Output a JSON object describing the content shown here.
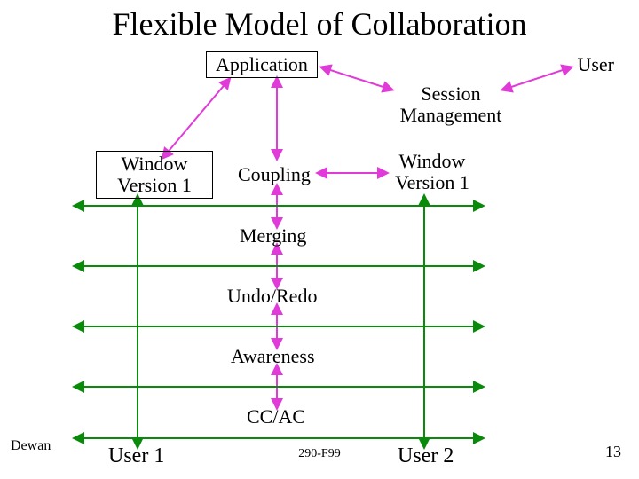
{
  "title": "Flexible Model of Collaboration",
  "nodes": {
    "application": "Application",
    "session_mgmt": "Session\nManagement",
    "window_left": "Window\nVersion 1",
    "window_right": "Window\nVersion 1",
    "coupling": "Coupling",
    "merging": "Merging",
    "undo": "Undo/Redo",
    "awareness": "Awareness",
    "ccac": "CC/AC"
  },
  "labels": {
    "user_top": "User",
    "user1": "User 1",
    "user2": "User 2"
  },
  "footer": {
    "author": "Dewan",
    "course": "290-F99",
    "page": "13"
  }
}
